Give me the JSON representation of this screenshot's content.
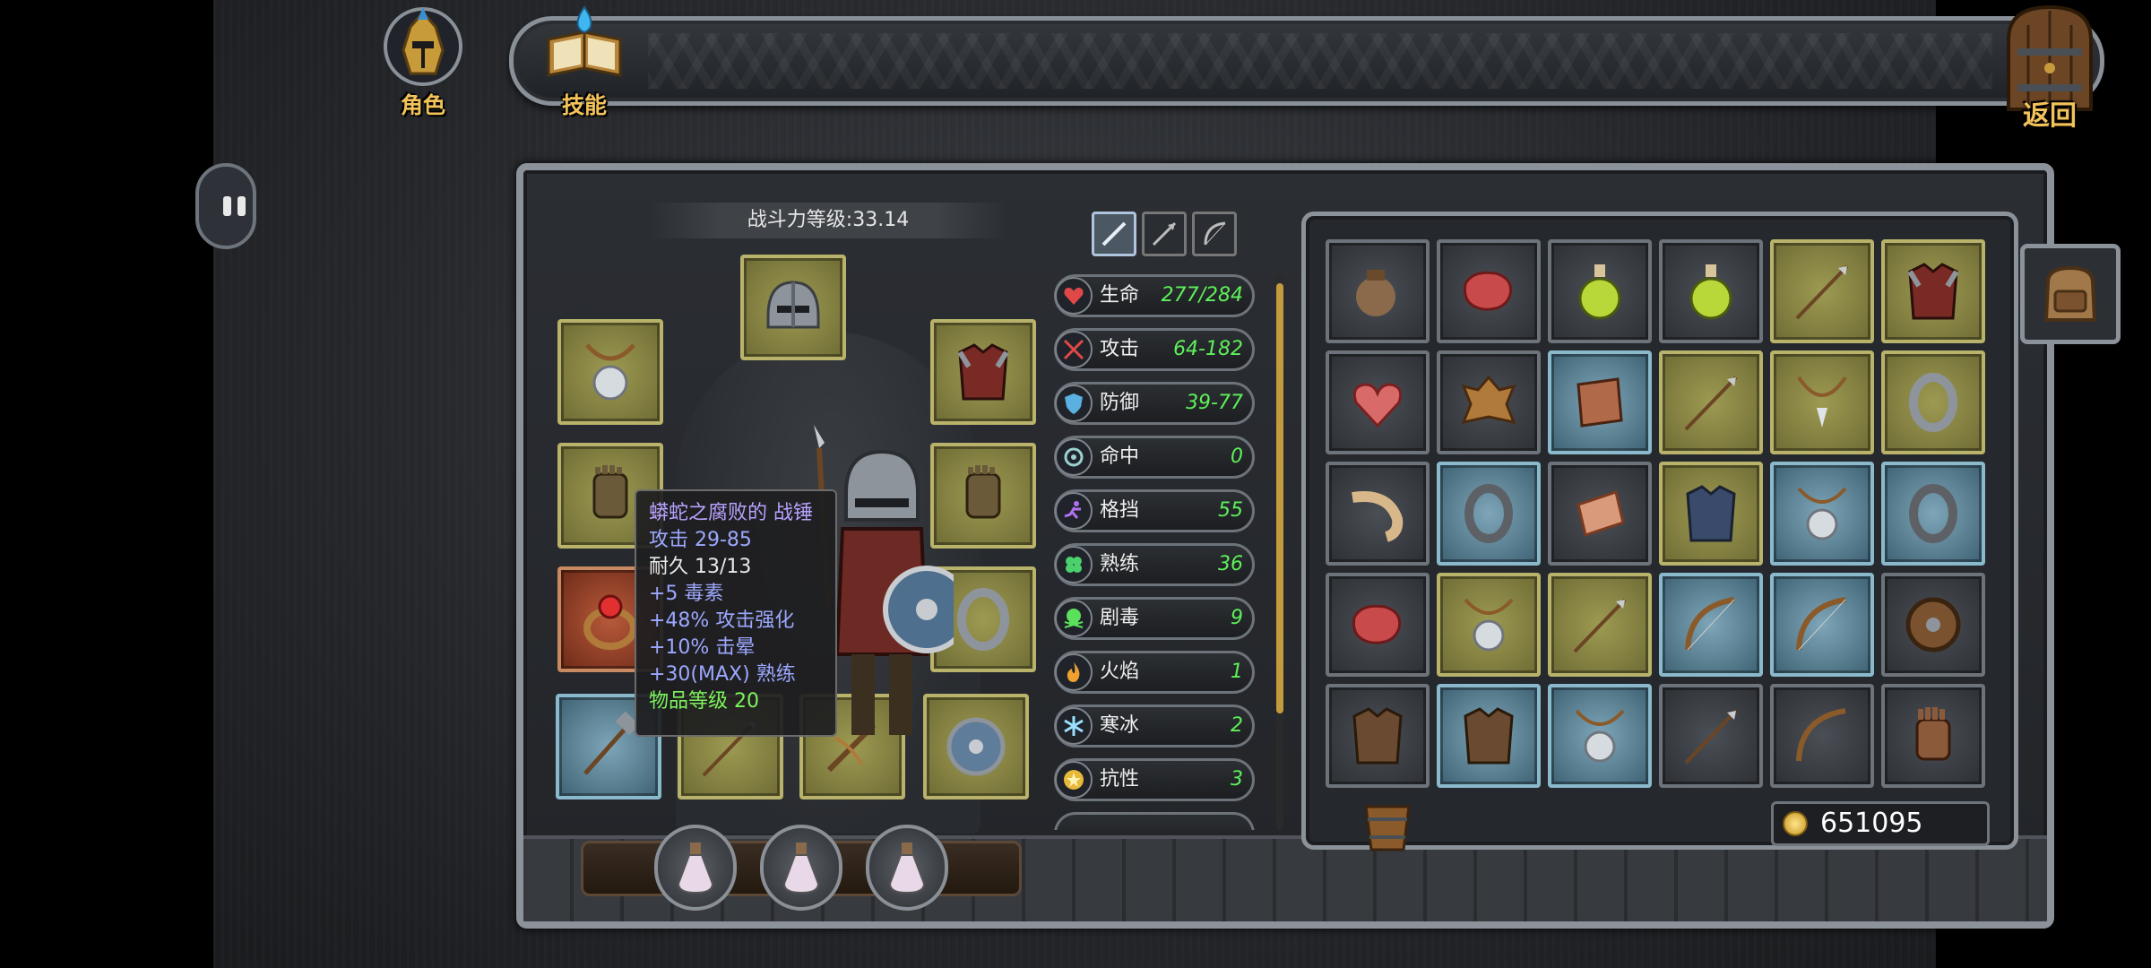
{
  "topbar": {
    "character_label": "角色",
    "skills_label": "技能",
    "return_label": "返回"
  },
  "power": {
    "text": "战斗力等级:33.14"
  },
  "tooltip": {
    "name": "蟒蛇之腐败的 战锤",
    "attack": "攻击 29-85",
    "durability": "耐久 13/13",
    "lines": [
      "+5 毒素",
      "+48% 攻击强化",
      "+10% 击晕",
      "+30(MAX) 熟练"
    ],
    "item_level": "物品等级 20"
  },
  "stats": [
    {
      "name": "生命",
      "value": "277/284",
      "icon": "heart-icon"
    },
    {
      "name": "攻击",
      "value": "64-182",
      "icon": "crossed-swords-icon"
    },
    {
      "name": "防御",
      "value": "39-77",
      "icon": "shield-icon"
    },
    {
      "name": "命中",
      "value": "0",
      "icon": "crosshair-icon"
    },
    {
      "name": "格挡",
      "value": "55",
      "icon": "dodge-runner-icon"
    },
    {
      "name": "熟练",
      "value": "36",
      "icon": "clover-icon"
    },
    {
      "name": "剧毒",
      "value": "9",
      "icon": "poison-skull-icon"
    },
    {
      "name": "火焰",
      "value": "1",
      "icon": "fire-icon"
    },
    {
      "name": "寒冰",
      "value": "2",
      "icon": "snowflake-icon"
    },
    {
      "name": "抗性",
      "value": "3",
      "icon": "star-badge-icon"
    }
  ],
  "gold": {
    "amount": "651095"
  },
  "colors": {
    "accent_gold": "#f3c35a",
    "stat_value": "#5ef05a",
    "tooltip_name": "#b9a2ff",
    "tooltip_level": "#7cf45c"
  }
}
